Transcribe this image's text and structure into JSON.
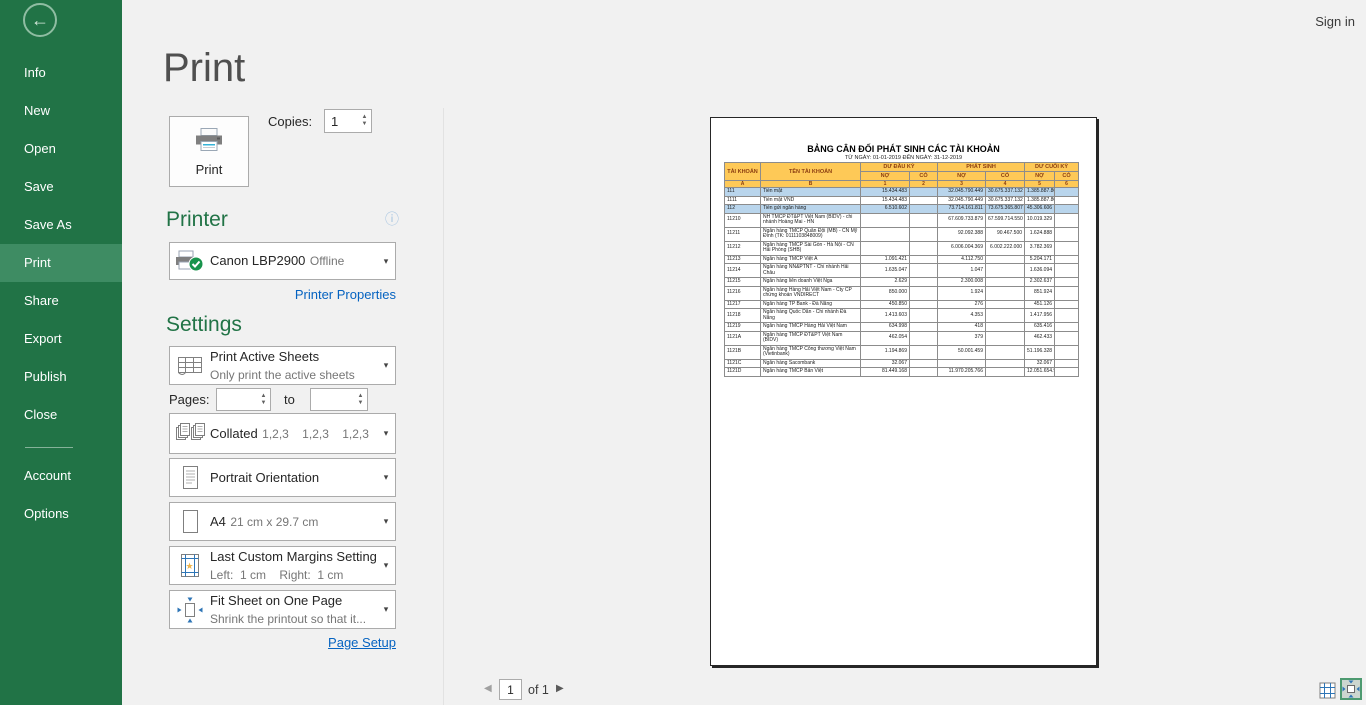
{
  "chrome": {
    "sign_in": "Sign in"
  },
  "icons": {
    "back": "←",
    "info": "ⓘ",
    "caret": "▾",
    "spin_up": "▲",
    "spin_down": "▼",
    "prev": "◀",
    "next": "▶"
  },
  "colors": {
    "excel_green": "#217346",
    "sidebar_selected": "#3e8c63",
    "link_blue": "#0563c1",
    "table_header_gold": "#fec957",
    "row_highlight_blue": "#b9d5ec"
  },
  "sidebar": {
    "items_top": [
      "Info",
      "New",
      "Open",
      "Save",
      "Save As",
      "Print",
      "Share",
      "Export",
      "Publish",
      "Close"
    ],
    "items_bottom": [
      "Account",
      "Options"
    ],
    "selected": "Print"
  },
  "main": {
    "title": "Print",
    "print_button_label": "Print",
    "copies_label": "Copies:",
    "copies_value": "1",
    "printer": {
      "heading": "Printer",
      "name": "Canon LBP2900",
      "status": "Offline",
      "properties_link": "Printer Properties"
    },
    "settings": {
      "heading": "Settings",
      "sheets": {
        "label": "Print Active Sheets",
        "sub": "Only print the active sheets"
      },
      "pages_label": "Pages:",
      "pages_from": "",
      "to_label": "to",
      "pages_to": "",
      "collation": {
        "label": "Collated",
        "sub": "1,2,3    1,2,3    1,2,3"
      },
      "orientation": {
        "label": "Portrait Orientation"
      },
      "paper": {
        "label": "A4",
        "sub": "21 cm x 29.7 cm"
      },
      "margins": {
        "label": "Last Custom Margins Setting",
        "sub": "Left:  1 cm    Right:  1 cm"
      },
      "scaling": {
        "label": "Fit Sheet on One Page",
        "sub": "Shrink the printout so that it..."
      },
      "page_setup_link": "Page Setup"
    }
  },
  "preview": {
    "title": "BẢNG CÂN ĐỐI PHÁT SINH CÁC TÀI KHOẢN",
    "subtitle": "TỪ NGÀY: 01-01-2019 ĐẾN NGÀY: 31-12-2019",
    "table": {
      "headers": {
        "account": "TÀI KHOẢN",
        "name": "TÊN TÀI KHOẢN",
        "opening": "DƯ ĐẦU KỲ",
        "period": "PHÁT SINH",
        "closing": "DƯ CUỐI KỲ"
      },
      "sub_headers": [
        "NỢ",
        "CÓ",
        "NỢ",
        "CÓ",
        "NỢ",
        "CÓ"
      ],
      "letters": [
        "A",
        "B",
        "1",
        "2",
        "3",
        "4",
        "5",
        "6"
      ],
      "rows": [
        {
          "code": "111",
          "name": "Tiền mặt",
          "od_no": "15.434.483",
          "od_co": "",
          "ps_no": "32.045.790.449",
          "ps_co": "30.675.337.132",
          "cl_no": "1.385.887.800",
          "cl_co": "",
          "hl": true
        },
        {
          "code": "1111",
          "name": "Tiền mặt VND",
          "od_no": "15.434.483",
          "od_co": "",
          "ps_no": "32.045.790.449",
          "ps_co": "30.675.337.132",
          "cl_no": "1.385.887.800",
          "cl_co": "",
          "hl": false
        },
        {
          "code": "112",
          "name": "Tiền gửi ngân hàng",
          "od_no": "6.510.602",
          "od_co": "",
          "ps_no": "73.714.161.811",
          "ps_co": "73.675.365.807",
          "cl_no": "45.306.606",
          "cl_co": "",
          "hl": true
        },
        {
          "code": "11210",
          "name": "NH TMCP ĐT&PT Việt Nam (BIDV) - chi nhánh Hoàng Mai - HN",
          "od_no": "",
          "od_co": "",
          "ps_no": "67.609.733.879",
          "ps_co": "67.599.714.550",
          "cl_no": "10.019.329",
          "cl_co": "",
          "hl": false
        },
        {
          "code": "11211",
          "name": "Ngân hàng TMCP Quân Đội (MB) - CN Mỹ Đình (TK: 0111103848009)",
          "od_no": "",
          "od_co": "",
          "ps_no": "92.092.388",
          "ps_co": "90.467.500",
          "cl_no": "1.624.888",
          "cl_co": "",
          "hl": false
        },
        {
          "code": "11212",
          "name": "Ngân hàng TMCP Sài Gòn - Hà Nội - CN Hải Phòng (SHB)",
          "od_no": "",
          "od_co": "",
          "ps_no": "6.006.004.369",
          "ps_co": "6.002.222.000",
          "cl_no": "3.782.369",
          "cl_co": "",
          "hl": false
        },
        {
          "code": "11213",
          "name": "Ngân hàng TMCP Việt Á",
          "od_no": "1.091.421",
          "od_co": "",
          "ps_no": "4.112.750",
          "ps_co": "",
          "cl_no": "5.204.171",
          "cl_co": "",
          "hl": false
        },
        {
          "code": "11214",
          "name": "Ngân hàng NN&PTNT - Chi nhánh Hải Châu",
          "od_no": "1.635.047",
          "od_co": "",
          "ps_no": "1.047",
          "ps_co": "",
          "cl_no": "1.636.094",
          "cl_co": "",
          "hl": false
        },
        {
          "code": "11215",
          "name": "Ngân hàng liên doanh Việt Nga",
          "od_no": "2.629",
          "od_co": "",
          "ps_no": "2.300.008",
          "ps_co": "",
          "cl_no": "2.302.637",
          "cl_co": "",
          "hl": false
        },
        {
          "code": "11216",
          "name": "Ngân hàng Hàng Hải Việt Nam - Cty CP chứng khoán VNDIRECT",
          "od_no": "850.000",
          "od_co": "",
          "ps_no": "1.924",
          "ps_co": "",
          "cl_no": "851.924",
          "cl_co": "",
          "hl": false
        },
        {
          "code": "11217",
          "name": "Ngân hàng TP Bank - Đà Nẵng",
          "od_no": "450.850",
          "od_co": "",
          "ps_no": "276",
          "ps_co": "",
          "cl_no": "451.126",
          "cl_co": "",
          "hl": false
        },
        {
          "code": "11218",
          "name": "Ngân hàng Quốc Dân - Chi nhánh Đà Nẵng",
          "od_no": "1.413.603",
          "od_co": "",
          "ps_no": "4.353",
          "ps_co": "",
          "cl_no": "1.417.956",
          "cl_co": "",
          "hl": false
        },
        {
          "code": "11219",
          "name": "Ngân hàng TMCP Hàng Hải Việt Nam",
          "od_no": "634.998",
          "od_co": "",
          "ps_no": "418",
          "ps_co": "",
          "cl_no": "635.416",
          "cl_co": "",
          "hl": false
        },
        {
          "code": "1121A",
          "name": "Ngân hàng TMCP ĐT&PT Việt Nam (BIDV)",
          "od_no": "462.054",
          "od_co": "",
          "ps_no": "379",
          "ps_co": "",
          "cl_no": "462.433",
          "cl_co": "",
          "hl": false
        },
        {
          "code": "1121B",
          "name": "Ngân hàng TMCP Công thương Việt Nam (Vietinbank)",
          "od_no": "1.194.869",
          "od_co": "",
          "ps_no": "50.001.459",
          "ps_co": "",
          "cl_no": "51.196.328",
          "cl_co": "",
          "hl": false
        },
        {
          "code": "1121C",
          "name": "Ngân hàng Sacombank",
          "od_no": "32.067",
          "od_co": "",
          "ps_no": "",
          "ps_co": "",
          "cl_no": "32.067",
          "cl_co": "",
          "hl": false
        },
        {
          "code": "1121D",
          "name": "Ngân hàng TMCP Bản Việt",
          "od_no": "81.449.168",
          "od_co": "",
          "ps_no": "11.970.205.766",
          "ps_co": "",
          "cl_no": "12.051.654.934",
          "cl_co": "",
          "hl": false
        }
      ]
    }
  },
  "pager": {
    "page": "1",
    "of_label": "of 1"
  }
}
